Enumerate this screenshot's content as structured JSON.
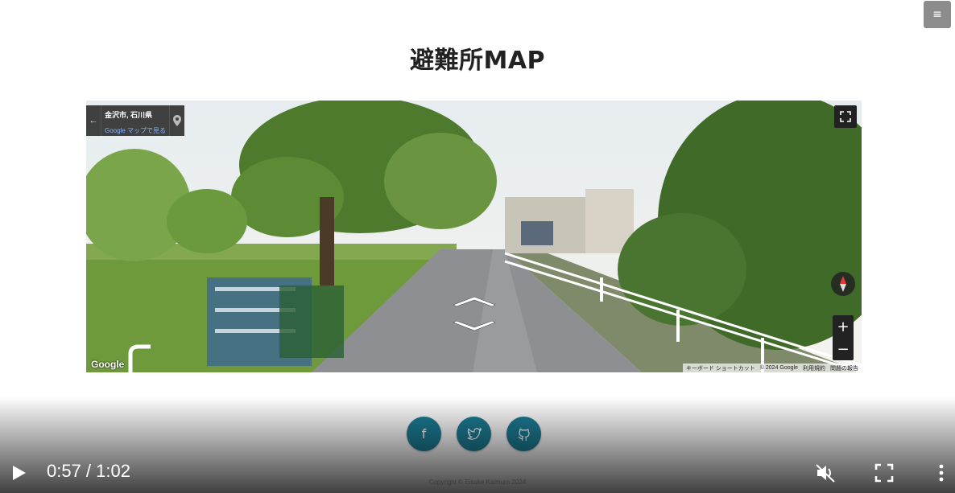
{
  "header": {
    "title": "避難所MAP",
    "menu_icon": "hamburger-icon"
  },
  "streetview": {
    "place": "金沢市, 石川県",
    "maps_link": "Google マップで見る",
    "logo": "Google",
    "attribution": [
      "キーボード ショートカット",
      "© 2024 Google",
      "利用規約",
      "問題の報告"
    ]
  },
  "social": [
    {
      "name": "facebook",
      "icon": "f"
    },
    {
      "name": "twitter",
      "icon": "twitter-icon"
    },
    {
      "name": "github",
      "icon": "github-icon"
    }
  ],
  "footer": {
    "copyright": "Copyright © Eisuke Kaimura 2024"
  },
  "video": {
    "time": "0:57 / 1:02"
  },
  "colors": {
    "social_bg": "#1d7d96",
    "menu_bg": "#8c8c8c"
  }
}
